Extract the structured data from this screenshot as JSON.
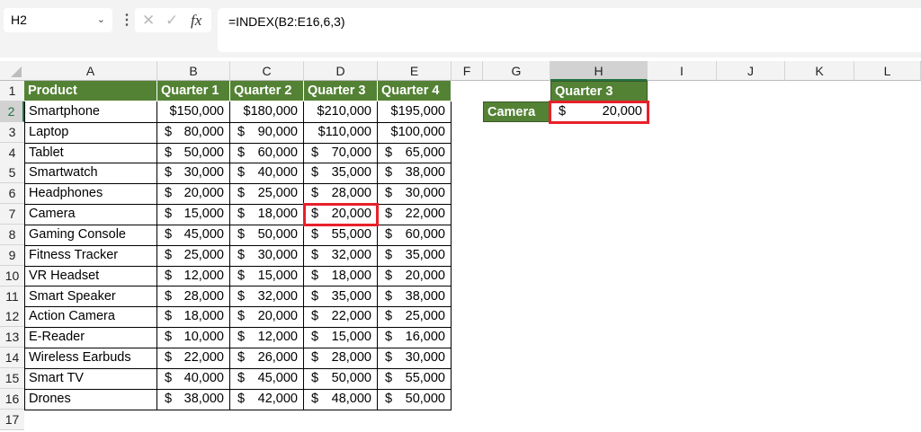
{
  "formula_bar": {
    "name_box": "H2",
    "formula": "=INDEX(B2:E16,6,3)",
    "cancel_icon": "✕",
    "enter_icon": "✓",
    "fx_label": "fx"
  },
  "columns": [
    "A",
    "B",
    "C",
    "D",
    "E",
    "F",
    "G",
    "H",
    "I",
    "J",
    "K",
    "L"
  ],
  "rows": [
    "1",
    "2",
    "3",
    "4",
    "5",
    "6",
    "7",
    "8",
    "9",
    "10",
    "11",
    "12",
    "13",
    "14",
    "15",
    "16",
    "17"
  ],
  "table": {
    "headers": [
      "Product",
      "Quarter 1",
      "Quarter 2",
      "Quarter 3",
      "Quarter 4"
    ],
    "data": [
      [
        "Smartphone",
        [
          "",
          "$150,000"
        ],
        [
          "",
          "$180,000"
        ],
        [
          "",
          "$210,000"
        ],
        [
          "",
          "$195,000"
        ]
      ],
      [
        "Laptop",
        [
          "$",
          "80,000"
        ],
        [
          "$",
          "90,000"
        ],
        [
          "",
          "$110,000"
        ],
        [
          "",
          "$100,000"
        ]
      ],
      [
        "Tablet",
        [
          "$",
          "50,000"
        ],
        [
          "$",
          "60,000"
        ],
        [
          "$",
          "70,000"
        ],
        [
          "$",
          "65,000"
        ]
      ],
      [
        "Smartwatch",
        [
          "$",
          "30,000"
        ],
        [
          "$",
          "40,000"
        ],
        [
          "$",
          "35,000"
        ],
        [
          "$",
          "38,000"
        ]
      ],
      [
        "Headphones",
        [
          "$",
          "20,000"
        ],
        [
          "$",
          "25,000"
        ],
        [
          "$",
          "28,000"
        ],
        [
          "$",
          "30,000"
        ]
      ],
      [
        "Camera",
        [
          "$",
          "15,000"
        ],
        [
          "$",
          "18,000"
        ],
        [
          "$",
          "20,000"
        ],
        [
          "$",
          "22,000"
        ]
      ],
      [
        "Gaming Console",
        [
          "$",
          "45,000"
        ],
        [
          "$",
          "50,000"
        ],
        [
          "$",
          "55,000"
        ],
        [
          "$",
          "60,000"
        ]
      ],
      [
        "Fitness Tracker",
        [
          "$",
          "25,000"
        ],
        [
          "$",
          "30,000"
        ],
        [
          "$",
          "32,000"
        ],
        [
          "$",
          "35,000"
        ]
      ],
      [
        "VR Headset",
        [
          "$",
          "12,000"
        ],
        [
          "$",
          "15,000"
        ],
        [
          "$",
          "18,000"
        ],
        [
          "$",
          "20,000"
        ]
      ],
      [
        "Smart Speaker",
        [
          "$",
          "28,000"
        ],
        [
          "$",
          "32,000"
        ],
        [
          "$",
          "35,000"
        ],
        [
          "$",
          "38,000"
        ]
      ],
      [
        "Action Camera",
        [
          "$",
          "18,000"
        ],
        [
          "$",
          "20,000"
        ],
        [
          "$",
          "22,000"
        ],
        [
          "$",
          "25,000"
        ]
      ],
      [
        "E-Reader",
        [
          "$",
          "10,000"
        ],
        [
          "$",
          "12,000"
        ],
        [
          "$",
          "15,000"
        ],
        [
          "$",
          "16,000"
        ]
      ],
      [
        "Wireless Earbuds",
        [
          "$",
          "22,000"
        ],
        [
          "$",
          "26,000"
        ],
        [
          "$",
          "28,000"
        ],
        [
          "$",
          "30,000"
        ]
      ],
      [
        "Smart TV",
        [
          "$",
          "40,000"
        ],
        [
          "$",
          "45,000"
        ],
        [
          "$",
          "50,000"
        ],
        [
          "$",
          "55,000"
        ]
      ],
      [
        "Drones",
        [
          "$",
          "38,000"
        ],
        [
          "$",
          "42,000"
        ],
        [
          "$",
          "48,000"
        ],
        [
          "$",
          "50,000"
        ]
      ]
    ]
  },
  "lookup": {
    "header": "Quarter 3",
    "label": "Camera",
    "sym": "$",
    "value": "20,000"
  },
  "colors": {
    "header_green": "#548235",
    "highlight_red": "#e8202a"
  }
}
